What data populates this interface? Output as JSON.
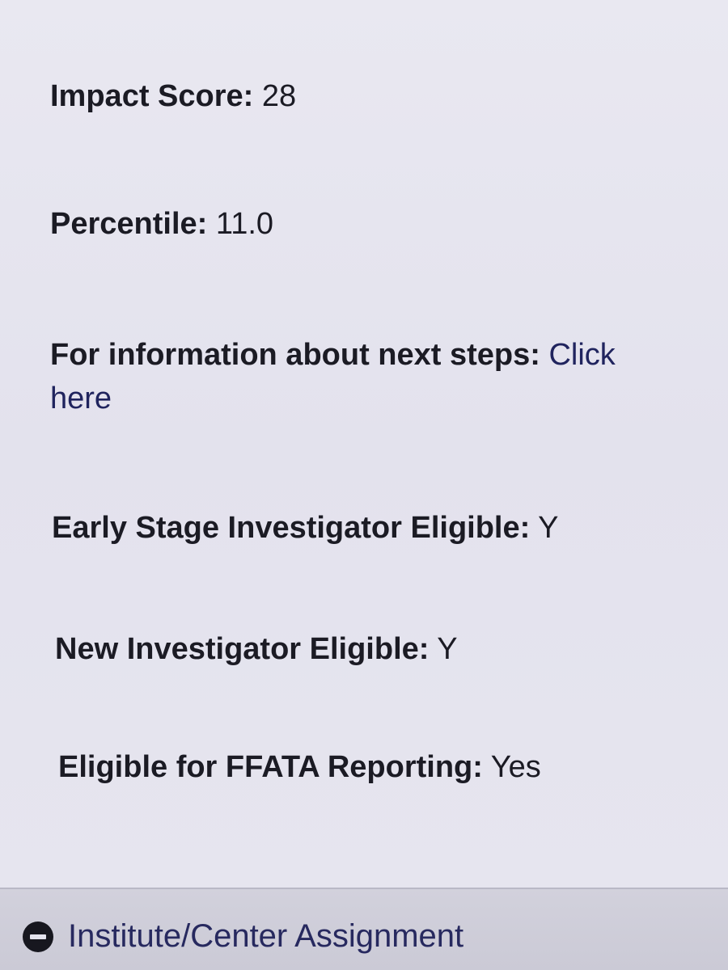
{
  "fields": {
    "impact_score": {
      "label": "Impact Score:",
      "value": "28"
    },
    "percentile": {
      "label": "Percentile:",
      "value": "11.0"
    },
    "next_steps": {
      "label": "For information about next steps:",
      "link_part1": "Click",
      "link_part2": "here"
    },
    "early_stage": {
      "label": "Early Stage Investigator Eligible:",
      "value": "Y"
    },
    "new_investigator": {
      "label": "New Investigator Eligible:",
      "value": "Y"
    },
    "ffata": {
      "label": "Eligible for FFATA Reporting:",
      "value": "Yes"
    }
  },
  "section": {
    "title": "Institute/Center Assignment",
    "icon": "collapse-minus-icon"
  },
  "colors": {
    "background": "#e4e3ee",
    "text": "#1b1b24",
    "link": "#20245e"
  }
}
